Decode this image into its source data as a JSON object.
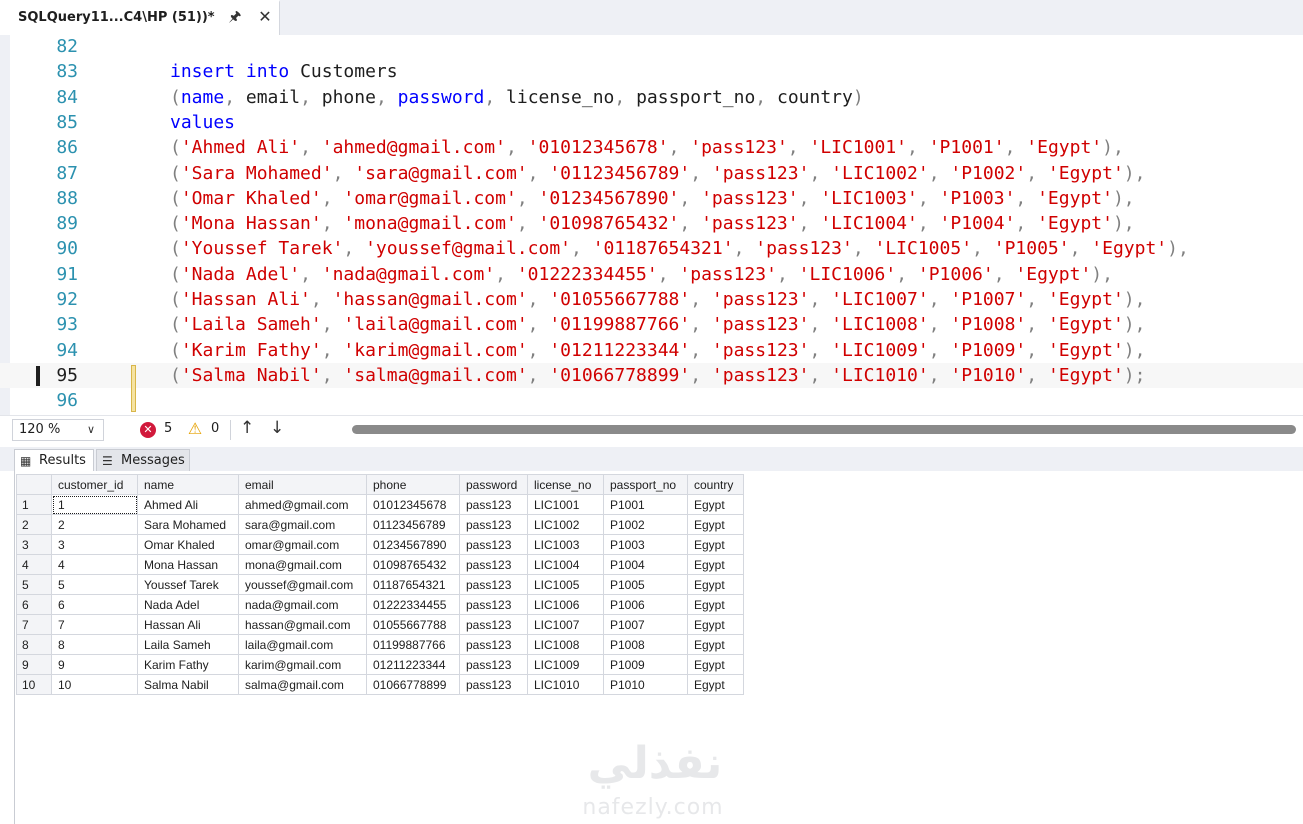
{
  "tab": {
    "title": "SQLQuery11...C4\\HP (51))*",
    "pin_icon": "pin-icon",
    "close_icon": "close-icon"
  },
  "editor": {
    "current_line": "95",
    "lines": [
      {
        "n": "82",
        "tokens": []
      },
      {
        "n": "83",
        "tokens": [
          [
            "kw",
            "insert"
          ],
          [
            "t",
            " "
          ],
          [
            "kw",
            "into"
          ],
          [
            "t",
            " Customers"
          ]
        ]
      },
      {
        "n": "84",
        "tokens": [
          [
            "p",
            "("
          ],
          [
            "kw",
            "name"
          ],
          [
            "p",
            ","
          ],
          [
            "t",
            " email"
          ],
          [
            "p",
            ","
          ],
          [
            "t",
            " phone"
          ],
          [
            "p",
            ","
          ],
          [
            "t",
            " "
          ],
          [
            "kw",
            "password"
          ],
          [
            "p",
            ","
          ],
          [
            "t",
            " license_no"
          ],
          [
            "p",
            ","
          ],
          [
            "t",
            " passport_no"
          ],
          [
            "p",
            ","
          ],
          [
            "t",
            " country"
          ],
          [
            "p",
            ")"
          ]
        ]
      },
      {
        "n": "85",
        "tokens": [
          [
            "kw",
            "values"
          ]
        ]
      },
      {
        "n": "86",
        "tokens": [
          [
            "p",
            "("
          ],
          [
            "s",
            "'Ahmed Ali'"
          ],
          [
            "p",
            ","
          ],
          [
            "t",
            " "
          ],
          [
            "s",
            "'ahmed@gmail.com'"
          ],
          [
            "p",
            ","
          ],
          [
            "t",
            " "
          ],
          [
            "s",
            "'01012345678'"
          ],
          [
            "p",
            ","
          ],
          [
            "t",
            " "
          ],
          [
            "s",
            "'pass123'"
          ],
          [
            "p",
            ","
          ],
          [
            "t",
            " "
          ],
          [
            "s",
            "'LIC1001'"
          ],
          [
            "p",
            ","
          ],
          [
            "t",
            " "
          ],
          [
            "s",
            "'P1001'"
          ],
          [
            "p",
            ","
          ],
          [
            "t",
            " "
          ],
          [
            "s",
            "'Egypt'"
          ],
          [
            "p",
            "),"
          ]
        ]
      },
      {
        "n": "87",
        "tokens": [
          [
            "p",
            "("
          ],
          [
            "s",
            "'Sara Mohamed'"
          ],
          [
            "p",
            ","
          ],
          [
            "t",
            " "
          ],
          [
            "s",
            "'sara@gmail.com'"
          ],
          [
            "p",
            ","
          ],
          [
            "t",
            " "
          ],
          [
            "s",
            "'01123456789'"
          ],
          [
            "p",
            ","
          ],
          [
            "t",
            " "
          ],
          [
            "s",
            "'pass123'"
          ],
          [
            "p",
            ","
          ],
          [
            "t",
            " "
          ],
          [
            "s",
            "'LIC1002'"
          ],
          [
            "p",
            ","
          ],
          [
            "t",
            " "
          ],
          [
            "s",
            "'P1002'"
          ],
          [
            "p",
            ","
          ],
          [
            "t",
            " "
          ],
          [
            "s",
            "'Egypt'"
          ],
          [
            "p",
            "),"
          ]
        ]
      },
      {
        "n": "88",
        "tokens": [
          [
            "p",
            "("
          ],
          [
            "s",
            "'Omar Khaled'"
          ],
          [
            "p",
            ","
          ],
          [
            "t",
            " "
          ],
          [
            "s",
            "'omar@gmail.com'"
          ],
          [
            "p",
            ","
          ],
          [
            "t",
            " "
          ],
          [
            "s",
            "'01234567890'"
          ],
          [
            "p",
            ","
          ],
          [
            "t",
            " "
          ],
          [
            "s",
            "'pass123'"
          ],
          [
            "p",
            ","
          ],
          [
            "t",
            " "
          ],
          [
            "s",
            "'LIC1003'"
          ],
          [
            "p",
            ","
          ],
          [
            "t",
            " "
          ],
          [
            "s",
            "'P1003'"
          ],
          [
            "p",
            ","
          ],
          [
            "t",
            " "
          ],
          [
            "s",
            "'Egypt'"
          ],
          [
            "p",
            "),"
          ]
        ]
      },
      {
        "n": "89",
        "tokens": [
          [
            "p",
            "("
          ],
          [
            "s",
            "'Mona Hassan'"
          ],
          [
            "p",
            ","
          ],
          [
            "t",
            " "
          ],
          [
            "s",
            "'mona@gmail.com'"
          ],
          [
            "p",
            ","
          ],
          [
            "t",
            " "
          ],
          [
            "s",
            "'01098765432'"
          ],
          [
            "p",
            ","
          ],
          [
            "t",
            " "
          ],
          [
            "s",
            "'pass123'"
          ],
          [
            "p",
            ","
          ],
          [
            "t",
            " "
          ],
          [
            "s",
            "'LIC1004'"
          ],
          [
            "p",
            ","
          ],
          [
            "t",
            " "
          ],
          [
            "s",
            "'P1004'"
          ],
          [
            "p",
            ","
          ],
          [
            "t",
            " "
          ],
          [
            "s",
            "'Egypt'"
          ],
          [
            "p",
            "),"
          ]
        ]
      },
      {
        "n": "90",
        "tokens": [
          [
            "p",
            "("
          ],
          [
            "s",
            "'Youssef Tarek'"
          ],
          [
            "p",
            ","
          ],
          [
            "t",
            " "
          ],
          [
            "s",
            "'youssef@gmail.com'"
          ],
          [
            "p",
            ","
          ],
          [
            "t",
            " "
          ],
          [
            "s",
            "'01187654321'"
          ],
          [
            "p",
            ","
          ],
          [
            "t",
            " "
          ],
          [
            "s",
            "'pass123'"
          ],
          [
            "p",
            ","
          ],
          [
            "t",
            " "
          ],
          [
            "s",
            "'LIC1005'"
          ],
          [
            "p",
            ","
          ],
          [
            "t",
            " "
          ],
          [
            "s",
            "'P1005'"
          ],
          [
            "p",
            ","
          ],
          [
            "t",
            " "
          ],
          [
            "s",
            "'Egypt'"
          ],
          [
            "p",
            "),"
          ]
        ]
      },
      {
        "n": "91",
        "tokens": [
          [
            "p",
            "("
          ],
          [
            "s",
            "'Nada Adel'"
          ],
          [
            "p",
            ","
          ],
          [
            "t",
            " "
          ],
          [
            "s",
            "'nada@gmail.com'"
          ],
          [
            "p",
            ","
          ],
          [
            "t",
            " "
          ],
          [
            "s",
            "'01222334455'"
          ],
          [
            "p",
            ","
          ],
          [
            "t",
            " "
          ],
          [
            "s",
            "'pass123'"
          ],
          [
            "p",
            ","
          ],
          [
            "t",
            " "
          ],
          [
            "s",
            "'LIC1006'"
          ],
          [
            "p",
            ","
          ],
          [
            "t",
            " "
          ],
          [
            "s",
            "'P1006'"
          ],
          [
            "p",
            ","
          ],
          [
            "t",
            " "
          ],
          [
            "s",
            "'Egypt'"
          ],
          [
            "p",
            "),"
          ]
        ]
      },
      {
        "n": "92",
        "tokens": [
          [
            "p",
            "("
          ],
          [
            "s",
            "'Hassan Ali'"
          ],
          [
            "p",
            ","
          ],
          [
            "t",
            " "
          ],
          [
            "s",
            "'hassan@gmail.com'"
          ],
          [
            "p",
            ","
          ],
          [
            "t",
            " "
          ],
          [
            "s",
            "'01055667788'"
          ],
          [
            "p",
            ","
          ],
          [
            "t",
            " "
          ],
          [
            "s",
            "'pass123'"
          ],
          [
            "p",
            ","
          ],
          [
            "t",
            " "
          ],
          [
            "s",
            "'LIC1007'"
          ],
          [
            "p",
            ","
          ],
          [
            "t",
            " "
          ],
          [
            "s",
            "'P1007'"
          ],
          [
            "p",
            ","
          ],
          [
            "t",
            " "
          ],
          [
            "s",
            "'Egypt'"
          ],
          [
            "p",
            "),"
          ]
        ]
      },
      {
        "n": "93",
        "tokens": [
          [
            "p",
            "("
          ],
          [
            "s",
            "'Laila Sameh'"
          ],
          [
            "p",
            ","
          ],
          [
            "t",
            " "
          ],
          [
            "s",
            "'laila@gmail.com'"
          ],
          [
            "p",
            ","
          ],
          [
            "t",
            " "
          ],
          [
            "s",
            "'01199887766'"
          ],
          [
            "p",
            ","
          ],
          [
            "t",
            " "
          ],
          [
            "s",
            "'pass123'"
          ],
          [
            "p",
            ","
          ],
          [
            "t",
            " "
          ],
          [
            "s",
            "'LIC1008'"
          ],
          [
            "p",
            ","
          ],
          [
            "t",
            " "
          ],
          [
            "s",
            "'P1008'"
          ],
          [
            "p",
            ","
          ],
          [
            "t",
            " "
          ],
          [
            "s",
            "'Egypt'"
          ],
          [
            "p",
            "),"
          ]
        ]
      },
      {
        "n": "94",
        "tokens": [
          [
            "p",
            "("
          ],
          [
            "s",
            "'Karim Fathy'"
          ],
          [
            "p",
            ","
          ],
          [
            "t",
            " "
          ],
          [
            "s",
            "'karim@gmail.com'"
          ],
          [
            "p",
            ","
          ],
          [
            "t",
            " "
          ],
          [
            "s",
            "'01211223344'"
          ],
          [
            "p",
            ","
          ],
          [
            "t",
            " "
          ],
          [
            "s",
            "'pass123'"
          ],
          [
            "p",
            ","
          ],
          [
            "t",
            " "
          ],
          [
            "s",
            "'LIC1009'"
          ],
          [
            "p",
            ","
          ],
          [
            "t",
            " "
          ],
          [
            "s",
            "'P1009'"
          ],
          [
            "p",
            ","
          ],
          [
            "t",
            " "
          ],
          [
            "s",
            "'Egypt'"
          ],
          [
            "p",
            "),"
          ]
        ]
      },
      {
        "n": "95",
        "tokens": [
          [
            "p",
            "("
          ],
          [
            "s",
            "'Salma Nabil'"
          ],
          [
            "p",
            ","
          ],
          [
            "t",
            " "
          ],
          [
            "s",
            "'salma@gmail.com'"
          ],
          [
            "p",
            ","
          ],
          [
            "t",
            " "
          ],
          [
            "s",
            "'01066778899'"
          ],
          [
            "p",
            ","
          ],
          [
            "t",
            " "
          ],
          [
            "s",
            "'pass123'"
          ],
          [
            "p",
            ","
          ],
          [
            "t",
            " "
          ],
          [
            "s",
            "'LIC1010'"
          ],
          [
            "p",
            ","
          ],
          [
            "t",
            " "
          ],
          [
            "s",
            "'P1010'"
          ],
          [
            "p",
            ","
          ],
          [
            "t",
            " "
          ],
          [
            "s",
            "'Egypt'"
          ],
          [
            "p",
            ");"
          ]
        ]
      },
      {
        "n": "96",
        "tokens": []
      }
    ]
  },
  "status": {
    "zoom": "120 %",
    "errors": "5",
    "warnings": "0",
    "error_icon": "error-icon",
    "warning_icon": "warning-icon"
  },
  "result_tabs": {
    "results": "Results",
    "messages": "Messages"
  },
  "grid": {
    "columns": [
      "customer_id",
      "name",
      "email",
      "phone",
      "password",
      "license_no",
      "passport_no",
      "country"
    ],
    "rows": [
      [
        "1",
        "1",
        "Ahmed Ali",
        "ahmed@gmail.com",
        "01012345678",
        "pass123",
        "LIC1001",
        "P1001",
        "Egypt"
      ],
      [
        "2",
        "2",
        "Sara Mohamed",
        "sara@gmail.com",
        "01123456789",
        "pass123",
        "LIC1002",
        "P1002",
        "Egypt"
      ],
      [
        "3",
        "3",
        "Omar Khaled",
        "omar@gmail.com",
        "01234567890",
        "pass123",
        "LIC1003",
        "P1003",
        "Egypt"
      ],
      [
        "4",
        "4",
        "Mona Hassan",
        "mona@gmail.com",
        "01098765432",
        "pass123",
        "LIC1004",
        "P1004",
        "Egypt"
      ],
      [
        "5",
        "5",
        "Youssef Tarek",
        "youssef@gmail.com",
        "01187654321",
        "pass123",
        "LIC1005",
        "P1005",
        "Egypt"
      ],
      [
        "6",
        "6",
        "Nada Adel",
        "nada@gmail.com",
        "01222334455",
        "pass123",
        "LIC1006",
        "P1006",
        "Egypt"
      ],
      [
        "7",
        "7",
        "Hassan Ali",
        "hassan@gmail.com",
        "01055667788",
        "pass123",
        "LIC1007",
        "P1007",
        "Egypt"
      ],
      [
        "8",
        "8",
        "Laila Sameh",
        "laila@gmail.com",
        "01199887766",
        "pass123",
        "LIC1008",
        "P1008",
        "Egypt"
      ],
      [
        "9",
        "9",
        "Karim Fathy",
        "karim@gmail.com",
        "01211223344",
        "pass123",
        "LIC1009",
        "P1009",
        "Egypt"
      ],
      [
        "10",
        "10",
        "Salma Nabil",
        "salma@gmail.com",
        "01066778899",
        "pass123",
        "LIC1010",
        "P1010",
        "Egypt"
      ]
    ]
  },
  "watermark": {
    "arabic": "نفذلي",
    "latin": "nafezly.com"
  },
  "colors": {
    "keyword": "#0000ff",
    "string": "#d00000",
    "line_number": "#2b91af",
    "punctuation": "#808080"
  }
}
